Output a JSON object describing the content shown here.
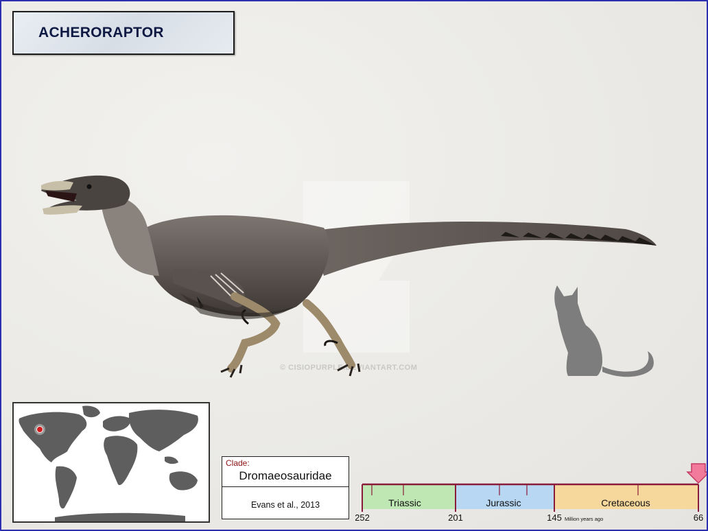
{
  "title": "ACHERORAPTOR",
  "watermark": "© CISIOPURPLE.DEVIANTART.COM",
  "clade": {
    "label": "Clade:",
    "name": "Dromaeosauridae",
    "citation": "Evans et al., 2013"
  },
  "timeline": {
    "periods": [
      "Triassic",
      "Jurassic",
      "Cretaceous"
    ],
    "ticks": [
      "252",
      "201",
      "145",
      "66"
    ],
    "unit": "Million years ago",
    "marker_value": 66,
    "colors": {
      "triassic": "#bfe7b3",
      "jurassic": "#b7d7f2",
      "cretaceous": "#f6d79c",
      "axis": "#8a1a3a",
      "marker": "#f27a9a"
    }
  },
  "map": {
    "location_marker_color": "#d11a1a",
    "land_color": "#5e5e5e"
  }
}
